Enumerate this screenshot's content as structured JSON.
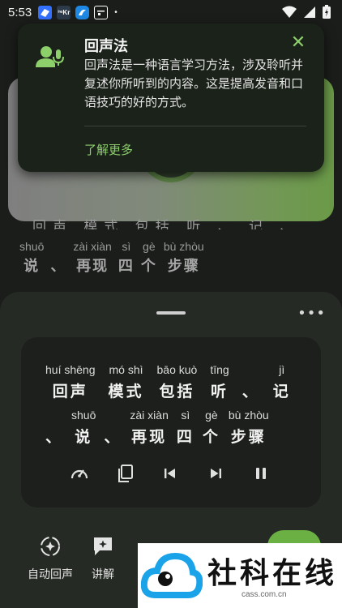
{
  "status_bar": {
    "time": "5:53",
    "app_icons": [
      "lark-icon",
      "kr-icon",
      "browser-icon",
      "calendar-icon"
    ],
    "kr_label": "³⁶Kr",
    "dot": "•",
    "colors": {
      "lark": "#3370ff",
      "kr": "#2d3a4a",
      "browser": "#1e88e5",
      "calendar": "#ffffff"
    }
  },
  "background_lesson": {
    "partial_row": "回声 模式 包括 听 、 记 、",
    "words": [
      {
        "py": "shuō",
        "hz": "说"
      },
      {
        "py": "",
        "hz": "、"
      },
      {
        "py": "zài xiàn",
        "hz": "再现"
      },
      {
        "py": "sì",
        "hz": "四"
      },
      {
        "py": "gè",
        "hz": "个"
      },
      {
        "py": "bù zhòu",
        "hz": "步骤"
      }
    ]
  },
  "popup": {
    "title": "回声法",
    "body": "回声法是一种语言学习方法，涉及聆听并复述你所听到的内容。这是提高发音和口语技巧的好的方式。",
    "link": "了解更多",
    "close_symbol": "✕",
    "accent_color": "#8ccf6b"
  },
  "sheet": {
    "more_symbol": "•••",
    "line1": [
      {
        "py": "huí shēng",
        "hz": "回声"
      },
      {
        "py": "mó shì",
        "hz": "模式"
      },
      {
        "py": "bāo kuò",
        "hz": "包括"
      },
      {
        "py": "tīng",
        "hz": "听"
      },
      {
        "py": "",
        "hz": "、"
      },
      {
        "py": "jì",
        "hz": "记"
      }
    ],
    "line2": [
      {
        "py": "",
        "hz": "、"
      },
      {
        "py": "shuō",
        "hz": "说"
      },
      {
        "py": "",
        "hz": "、"
      },
      {
        "py": "zài xiàn",
        "hz": "再现"
      },
      {
        "py": "sì",
        "hz": "四"
      },
      {
        "py": "gè",
        "hz": "个"
      },
      {
        "py": "bù zhòu",
        "hz": "步骤"
      }
    ],
    "controls": [
      "speed-icon",
      "copy-icon",
      "skip-previous-icon",
      "skip-next-icon",
      "pause-icon"
    ]
  },
  "bottom_nav": {
    "items": [
      {
        "label": "自动回声",
        "icon": "auto-echo-icon"
      },
      {
        "label": "讲解",
        "icon": "explain-icon"
      }
    ],
    "fab_color": "#6bb043"
  },
  "watermark": {
    "text": "社科在线",
    "sub": "cass.com.cn",
    "logo_color": "#1aa3e8"
  }
}
